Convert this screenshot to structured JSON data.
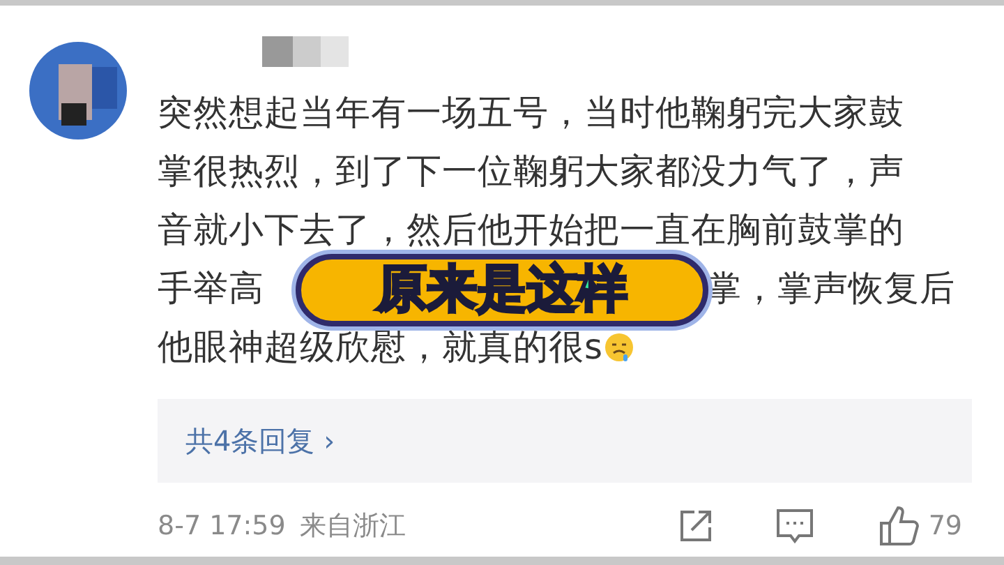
{
  "comment": {
    "lines": [
      "突然想起当年有一场五号，当时他鞠躬完大家鼓",
      "掌很热烈，到了下一位鞠躬大家都没力气了，声",
      "音就小下去了，然后他开始把一直在胸前鼓掌的"
    ],
    "line_4_left": "手举高",
    "line_4_right": "掌，掌声恢复后",
    "line_5": "他眼神超级欣慰，就真的很s"
  },
  "replies": {
    "label": "共4条回复",
    "chevron": "›"
  },
  "footer": {
    "time": "8-7 17:59",
    "location": "来自浙江",
    "likes": "79"
  },
  "caption": "原来是这样"
}
